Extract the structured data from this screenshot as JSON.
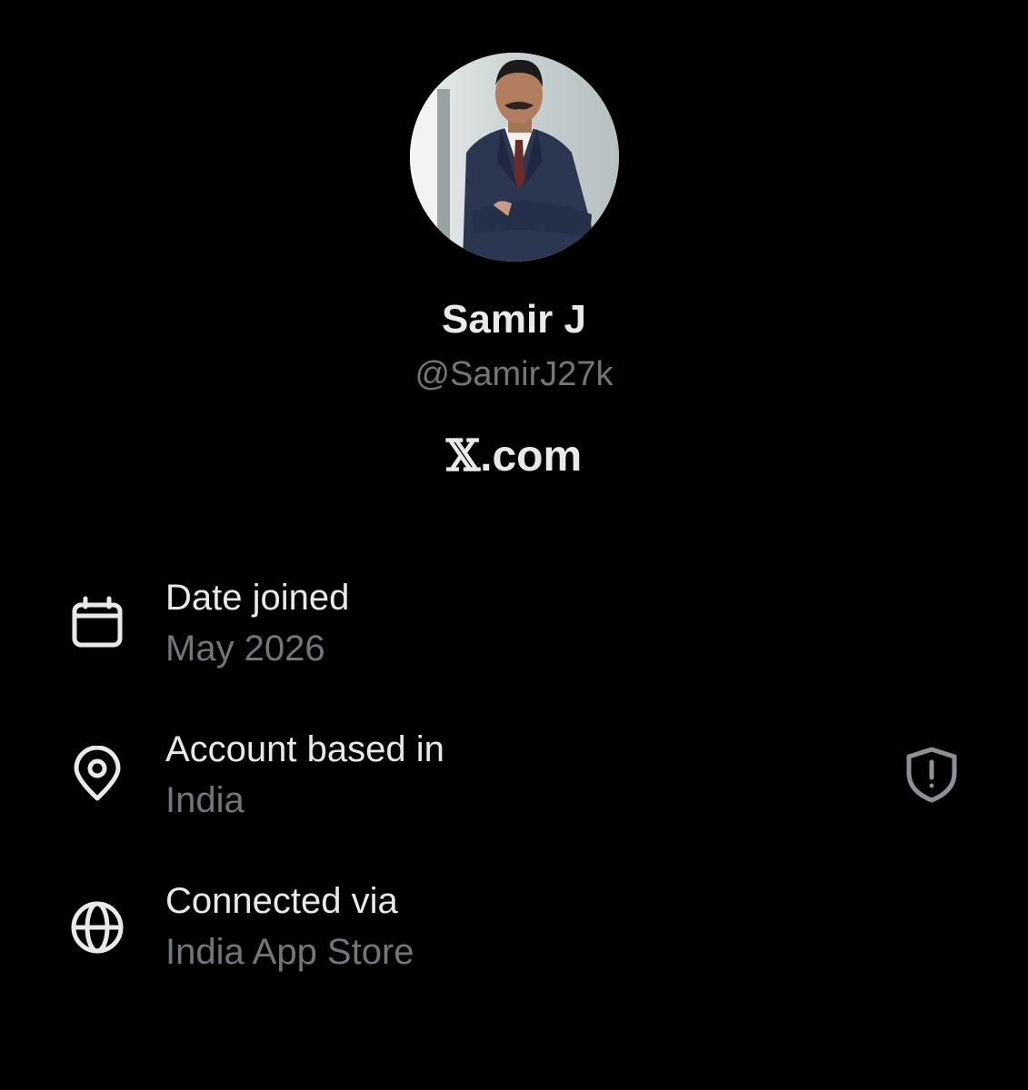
{
  "profile": {
    "avatar_alt": "profile photo",
    "display_name": "Samir J",
    "handle": "@SamirJ27k",
    "site_mark": "𝕏",
    "site_suffix": ".com"
  },
  "info": [
    {
      "icon": "calendar-icon",
      "label": "Date joined",
      "value": "May 2026"
    },
    {
      "icon": "location-pin-icon",
      "label": "Account based in",
      "value": "India",
      "badge_icon": "shield-alert-icon"
    },
    {
      "icon": "globe-icon",
      "label": "Connected via",
      "value": "India App Store"
    }
  ],
  "colors": {
    "background": "#000000",
    "primary_text": "#e7e9ea",
    "secondary_text": "#71767b"
  }
}
